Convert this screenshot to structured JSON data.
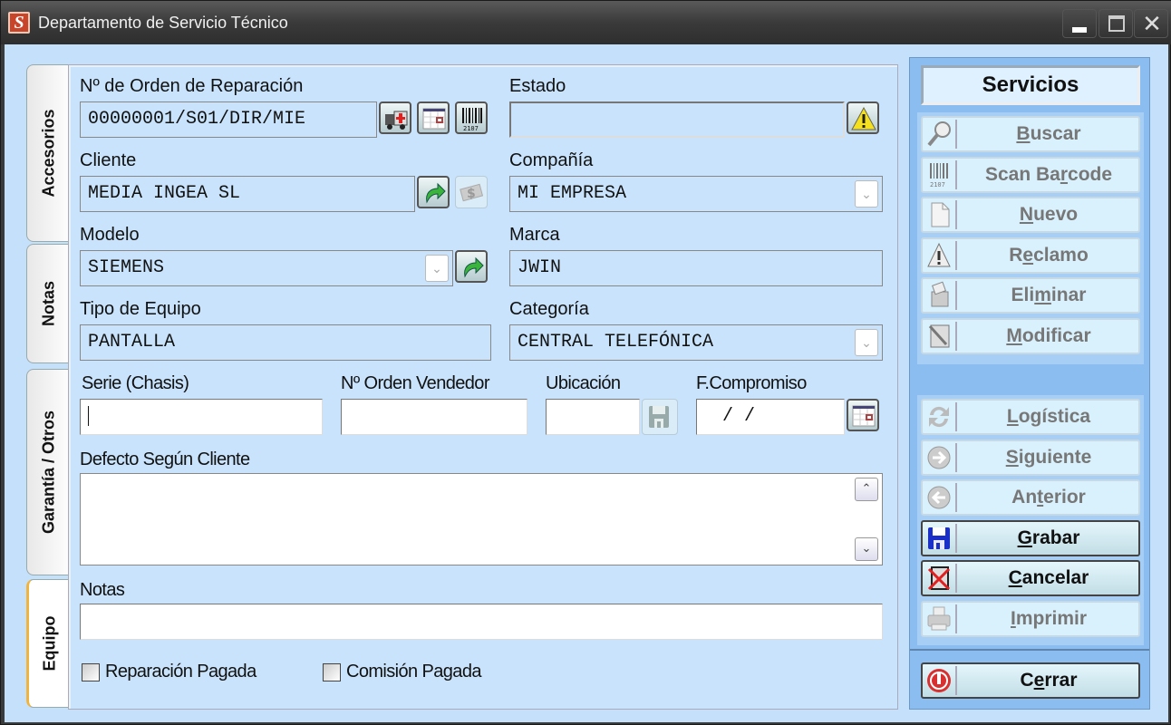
{
  "window": {
    "title": "Departamento de Servicio Técnico",
    "app_icon": "S",
    "controls": {
      "minimize": "minimize-icon",
      "maximize": "maximize-icon",
      "close": "✕"
    }
  },
  "tabs": [
    {
      "label": "Accesorios",
      "active": false
    },
    {
      "label": "Notas",
      "active": false
    },
    {
      "label": "Garantía / Otros",
      "active": false
    },
    {
      "label": "Equipo",
      "active": true
    }
  ],
  "form": {
    "orden": {
      "label": "Nº de Orden de Reparación",
      "value": "00000001/S01/DIR/MIE",
      "buttons": [
        "ambulance-icon",
        "calendar-icon",
        "barcode-icon"
      ]
    },
    "estado": {
      "label": "Estado",
      "value": "",
      "button": "warning-icon"
    },
    "cliente": {
      "label": "Cliente",
      "value": "MEDIA INGEA SL",
      "buttons": [
        "green-arrow-icon",
        "money-icon"
      ]
    },
    "compania": {
      "label": "Compañía",
      "value": "MI EMPRESA"
    },
    "modelo": {
      "label": "Modelo",
      "value": "SIEMENS",
      "button": "green-arrow-icon"
    },
    "marca": {
      "label": "Marca",
      "value": "JWIN"
    },
    "tipo_equipo": {
      "label": "Tipo de Equipo",
      "value": "PANTALLA"
    },
    "categoria": {
      "label": "Categoría",
      "value": "CENTRAL TELEFÓNICA"
    },
    "serie": {
      "label": "Serie (Chasis)",
      "value": ""
    },
    "orden_vendedor": {
      "label": "Nº Orden Vendedor",
      "value": ""
    },
    "ubicacion": {
      "label": "Ubicación",
      "value": ""
    },
    "f_compromiso": {
      "label": "F.Compromiso",
      "value": "  /  /"
    },
    "defecto": {
      "label": "Defecto Según Cliente",
      "value": ""
    },
    "notas": {
      "label": "Notas",
      "value": ""
    },
    "reparacion_pagada": {
      "label": "Reparación Pagada",
      "checked": false
    },
    "comision_pagada": {
      "label": "Comisión Pagada",
      "checked": false
    }
  },
  "services": {
    "title": "Servicios",
    "buttons": [
      {
        "pre": "",
        "ul": "B",
        "post": "uscar",
        "icon": "magnifier-icon",
        "enabled": false
      },
      {
        "pre": "Scan Ba",
        "ul": "r",
        "post": "code",
        "icon": "barcode-icon",
        "enabled": false
      },
      {
        "pre": "",
        "ul": "N",
        "post": "uevo",
        "icon": "new-document-icon",
        "enabled": false
      },
      {
        "pre": "R",
        "ul": "e",
        "post": "clamo",
        "icon": "warning-icon",
        "enabled": false
      },
      {
        "pre": "Eli",
        "ul": "m",
        "post": "inar",
        "icon": "trash-icon",
        "enabled": false
      },
      {
        "pre": "",
        "ul": "M",
        "post": "odificar",
        "icon": "edit-document-icon",
        "enabled": false
      },
      {
        "pre": "",
        "ul": "L",
        "post": "ogística",
        "icon": "refresh-icon",
        "enabled": false
      },
      {
        "pre": "",
        "ul": "S",
        "post": "iguiente",
        "icon": "arrow-right-circle-icon",
        "enabled": false
      },
      {
        "pre": "An",
        "ul": "t",
        "post": "erior",
        "icon": "arrow-left-circle-icon",
        "enabled": false
      },
      {
        "pre": "",
        "ul": "G",
        "post": "rabar",
        "icon": "floppy-disk-icon",
        "enabled": true
      },
      {
        "pre": "",
        "ul": "C",
        "post": "ancelar",
        "icon": "cancel-document-icon",
        "enabled": true
      },
      {
        "pre": "",
        "ul": "I",
        "post": "mprimir",
        "icon": "printer-icon",
        "enabled": false
      },
      {
        "pre": "C",
        "ul": "e",
        "post": "rrar",
        "icon": "power-stop-icon",
        "enabled": true
      }
    ]
  }
}
